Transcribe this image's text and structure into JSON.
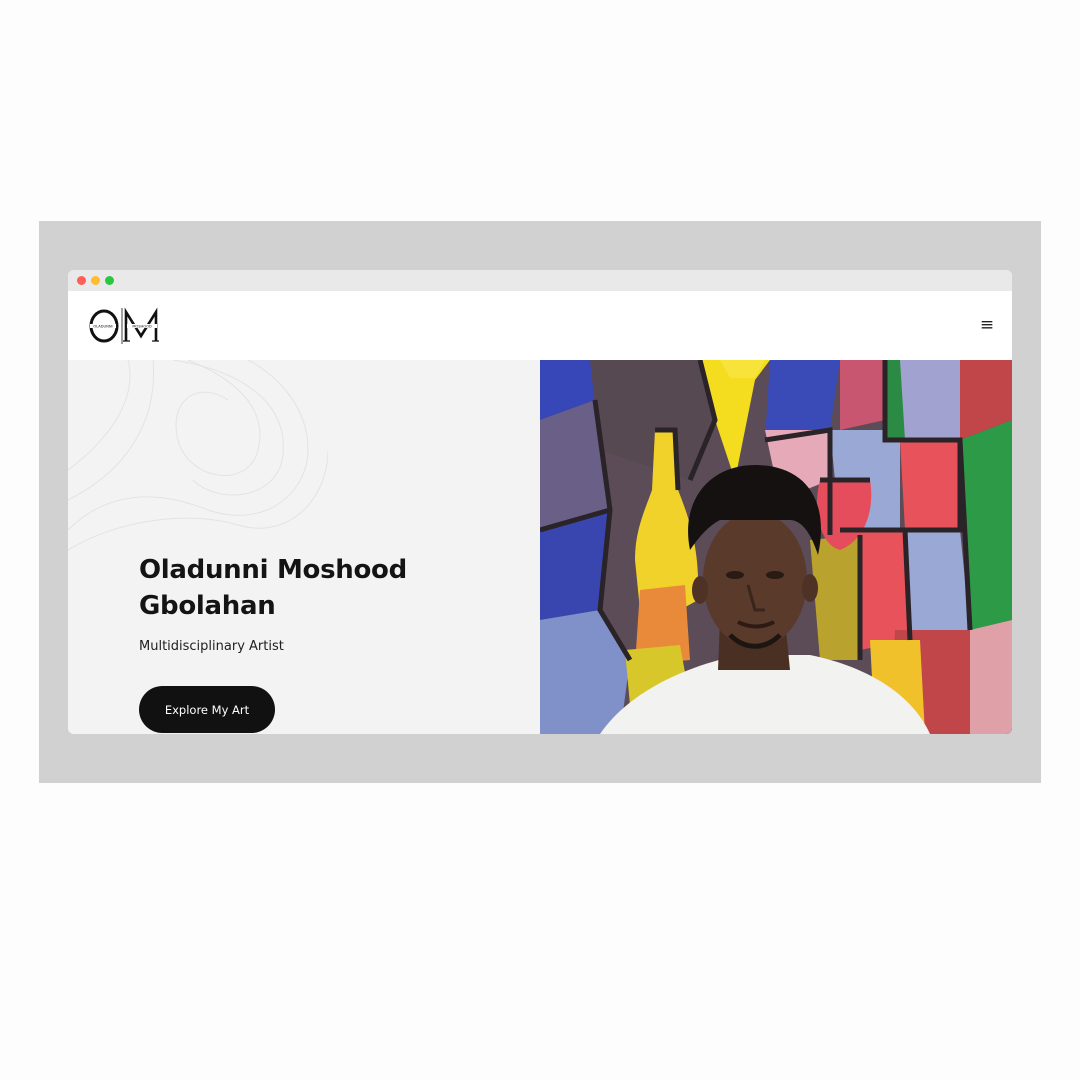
{
  "brand": {
    "logo_letters": "OM",
    "logo_small_left": "OLADUNNI",
    "logo_small_right": "MOSHOOD"
  },
  "nav": {
    "menu_icon": "≡"
  },
  "hero": {
    "title": "Oladunni Moshood Gbolahan",
    "subtitle": "Multidisciplinary Artist",
    "cta_label": "Explore My Art"
  },
  "icons": {
    "menu": "hamburger-menu-icon",
    "window_close": "close-dot-icon",
    "window_minimize": "minimize-dot-icon",
    "window_maximize": "maximize-dot-icon"
  },
  "colors": {
    "cta_background": "#111111",
    "hero_left_background": "#f3f3f3",
    "frame_background": "#d1d1d1"
  }
}
